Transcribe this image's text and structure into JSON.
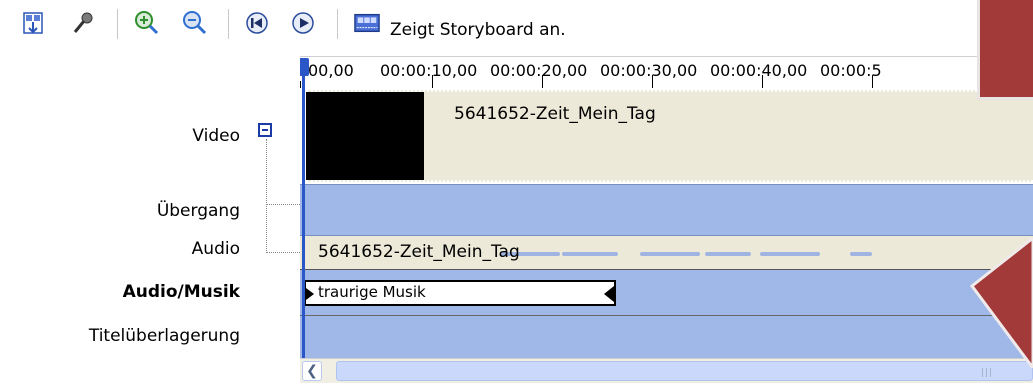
{
  "toolbar": {
    "buttons": [
      {
        "name": "storyboard-toggle-icon"
      },
      {
        "name": "narrate-mic-icon"
      },
      {
        "name": "zoom-in-icon"
      },
      {
        "name": "zoom-out-icon"
      },
      {
        "name": "rewind-icon"
      },
      {
        "name": "play-icon"
      },
      {
        "name": "storyboard-icon"
      }
    ],
    "storyboard_label": "Zeigt Storyboard an."
  },
  "tracks": {
    "video_label": "Video",
    "transition_label": "Übergang",
    "audio_label": "Audio",
    "music_label": "Audio/Musik",
    "title_label": "Titelüberlagerung"
  },
  "ruler": {
    "labels": [
      "00,00",
      "00:00:10,00",
      "00:00:20,00",
      "00:00:30,00",
      "00:00:40,00",
      "00:00:5"
    ]
  },
  "clips": {
    "video_title": "5641652-Zeit_Mein_Tag",
    "audio_title": "5641652-Zeit_Mein_Tag",
    "music_title": "traurige Musik"
  },
  "colors": {
    "track_blue": "#a0b8e8",
    "clip_beige": "#ece9d8",
    "playhead": "#2a56c8",
    "overlay_red": "#a23a3a"
  }
}
